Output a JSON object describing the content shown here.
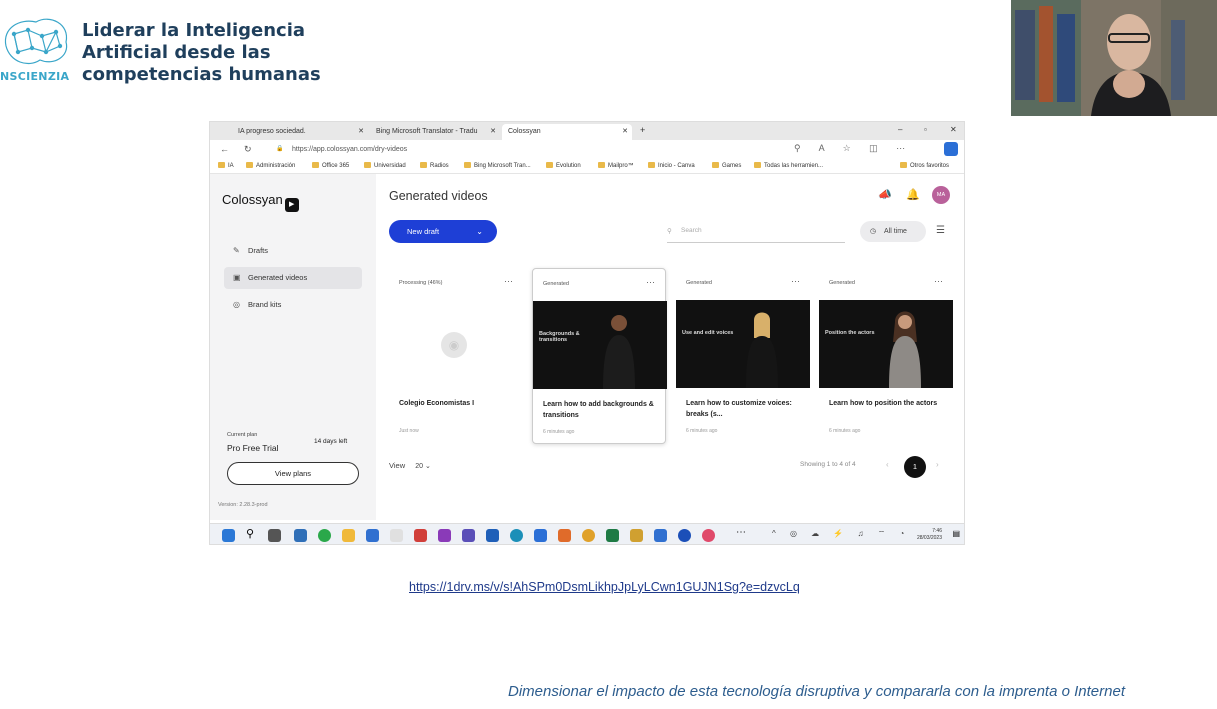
{
  "slide": {
    "logo_lines": [
      "Liderar la Inteligencia",
      "Artificial desde las",
      "competencias humanas"
    ],
    "logo_word": "NSCIENZIA",
    "link": "https://1drv.ms/v/s!AhSPm0DsmLikhpJpLyLCwn1GUJN1Sg?e=dzvcLq",
    "caption": "Dimensionar el impacto de esta tecnología disruptiva y compararla con la imprenta o Internet"
  },
  "browser": {
    "tabs": [
      {
        "label": "IA progreso sociedad."
      },
      {
        "label": "Bing Microsoft Translator - Tradu"
      },
      {
        "label": "Colossyan"
      }
    ],
    "url": "https://app.colossyan.com/dry-videos",
    "bookmarks": [
      "IA",
      "Administración",
      "Office 365",
      "Universidad",
      "Radios",
      "Bing Microsoft Tran...",
      "Evolution",
      "Mailpro™",
      "Inicio - Canva",
      "Games",
      "Todas las herramien...",
      "Otros favoritos"
    ]
  },
  "app": {
    "brand": "Colossyan",
    "nav": [
      {
        "label": "Drafts",
        "icon": "pencil-icon"
      },
      {
        "label": "Generated videos",
        "icon": "film-icon"
      },
      {
        "label": "Brand kits",
        "icon": "palette-icon"
      }
    ],
    "plan": {
      "label": "Current plan",
      "name": "Pro Free Trial",
      "days_left": "14 days left",
      "view_plans": "View plans"
    },
    "version": "Version: 2.28.3-prod",
    "title": "Generated videos",
    "new_draft": "New draft",
    "search_placeholder": "Search",
    "time_filter": "All time",
    "cards": [
      {
        "status": "Processing (46%)",
        "title": "Colegio Economistas I",
        "time": "Just now",
        "overlay": ""
      },
      {
        "status": "Generated",
        "title": "Learn how to add backgrounds & transitions",
        "time": "6 minutes ago",
        "overlay": "Backgrounds & transitions"
      },
      {
        "status": "Generated",
        "title": "Learn how to customize voices: breaks (s...",
        "time": "6 minutes ago",
        "overlay": "Use and edit voices"
      },
      {
        "status": "Generated",
        "title": "Learn how to position the actors",
        "time": "6 minutes ago",
        "overlay": "Position the actors"
      }
    ],
    "view_label": "View",
    "per_page": "20",
    "showing": "Showing 1 to 4 of 4",
    "page": "1"
  },
  "taskbar": {
    "time": "7:46",
    "date": "28/03/2023"
  },
  "colors": {
    "accent": "#1e3fd6",
    "caption": "#2d5d8e",
    "link": "#1f3a8a"
  }
}
